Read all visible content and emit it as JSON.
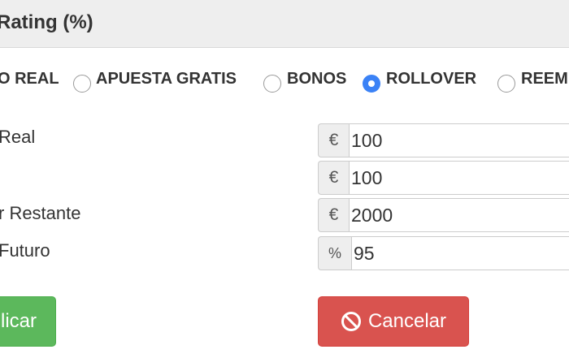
{
  "header": {
    "title": "Rating (%)"
  },
  "radios": [
    {
      "label": "O REAL",
      "checked": false
    },
    {
      "label": "APUESTA GRATIS",
      "checked": false
    },
    {
      "label": "BONOS",
      "checked": false
    },
    {
      "label": "ROLLOVER",
      "checked": true
    },
    {
      "label": "REEM",
      "checked": false
    }
  ],
  "fields": [
    {
      "label": "Real",
      "addon": "€",
      "value": "100"
    },
    {
      "label": "",
      "addon": "€",
      "value": "100"
    },
    {
      "label": "r Restante",
      "addon": "€",
      "value": "2000"
    },
    {
      "label": "Futuro",
      "addon": "%",
      "value": "95"
    }
  ],
  "buttons": {
    "apply_label": "licar",
    "cancel_label": "Cancelar",
    "cancel_icon": "ban-icon"
  },
  "colors": {
    "radio_checked": "#3b82f6",
    "apply": "#5cb85c",
    "cancel": "#d9534f",
    "header_bg": "#eeeeee"
  }
}
